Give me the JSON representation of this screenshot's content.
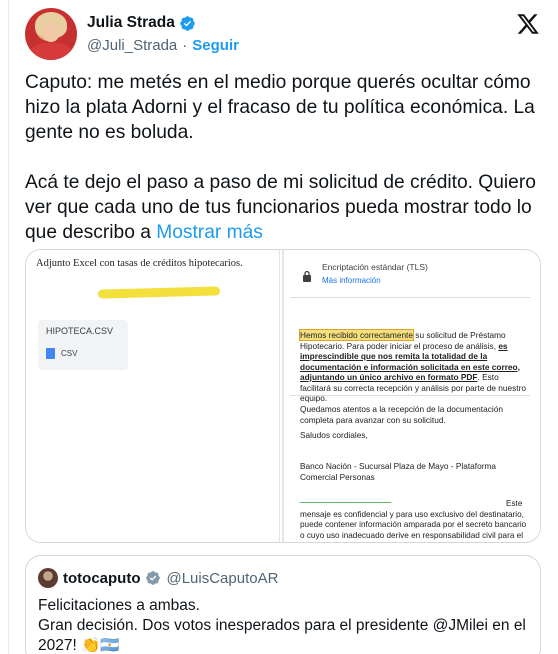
{
  "author": {
    "display_name": "Julia Strada",
    "handle": "@Juli_Strada",
    "separator": "·",
    "follow_label": "Seguir"
  },
  "icons": {
    "verified": "verified-badge-icon",
    "brand": "x-logo-icon"
  },
  "colors": {
    "accent": "#1d9bf0",
    "verified_gray": "#829aab",
    "highlight": "#f4e03c"
  },
  "tweet": {
    "paragraph_1": "Caputo: me metés en el medio porque querés ocultar cómo hizo la plata Adorni y el fracaso de tu política económica. La gente no es boluda.",
    "paragraph_2": "Acá te dejo el paso a paso de mi solicitud de crédito. Quiero ver que cada uno de tus funcionarios pueda mostrar todo lo que describo a",
    "show_more": "Mostrar más"
  },
  "media": {
    "left": {
      "title": "Adjunto Excel con tasas de créditos hipotecarios.",
      "attachment_name": "HIPOTECA.CSV",
      "attachment_type": "CSV"
    },
    "right": {
      "encryption_title": "Encriptación estándar (TLS)",
      "more_info": "Más información",
      "highlight": "Hemos recibido correctamente",
      "body_1": " su solicitud de Préstamo Hipotecario. Para poder iniciar el proceso de análisis, ",
      "body_bold": "es imprescindible que nos remita la totalidad de la documentación e información solicitada en este correo, adjuntando un único archivo en formato PDF",
      "body_2": ". Esto facilitará su correcta recepción y análisis por parte de nuestro equipo.",
      "waiting": "Quedamos atentos a la recepción de la documentación completa para avanzar con su solicitud.",
      "greeting": "Saludos cordiales,",
      "signature": "Banco Nación - Sucursal Plaza de Mayo - Plataforma Comercial Personas",
      "disclaimer": "Este mensaje es confidencial y para uso exclusivo del destinatario, puede contener información amparada por el secreto bancario o cuyo uso inadecuado derive en responsabilidad civil para el usuario o configurar"
    }
  },
  "quote": {
    "display_name": "totocaputo",
    "handle": "@LuisCaputoAR",
    "line_1": "Felicitaciones a ambas.",
    "line_2": "Gran decisión. Dos votos inesperados para el presidente @JMilei en el 2027! 👏🇦🇷"
  }
}
